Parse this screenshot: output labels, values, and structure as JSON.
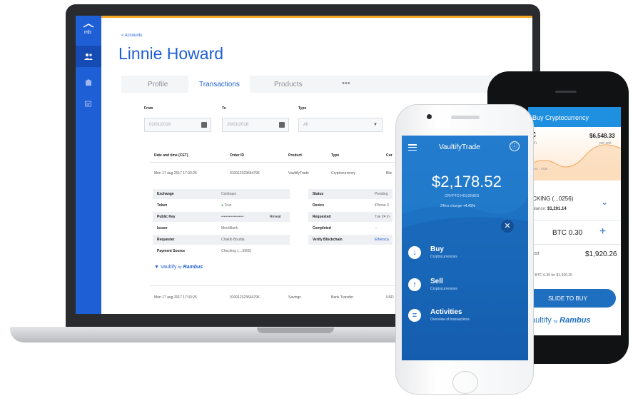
{
  "laptop": {
    "back_link": "« Accounts",
    "client_name": "Linnie Howard",
    "tabs": [
      "Profile",
      "Transactions",
      "Products",
      "•••"
    ],
    "filters": {
      "from_label": "From",
      "from_value": "01/01/2018",
      "to_label": "To",
      "to_value": "20/01/2018",
      "type_label": "Type",
      "type_value": "All"
    },
    "table": {
      "headers": [
        "Date and time (CET)",
        "Order ID",
        "Product",
        "Type",
        "Cur"
      ],
      "rows": [
        [
          "Mon 17 aug 2017 17:33:26",
          "0100123236647​96",
          "VaultifyTrade",
          "Cryptocurrency",
          "Bitc"
        ],
        [
          "Mon 17 aug 2017 17:33:26",
          "0100123236647​96",
          "Savings",
          "Bank Transfer",
          "USD"
        ]
      ]
    },
    "details_left": [
      {
        "k": "Exchange",
        "v": "Coinbase"
      },
      {
        "k": "Token",
        "v": "True"
      },
      {
        "k": "Public Key",
        "v": "••••••••••••••••••",
        "action": "Reveal"
      },
      {
        "k": "Issuer",
        "v": "MockBank"
      },
      {
        "k": "Requester",
        "v": "Chakib Boudia"
      },
      {
        "k": "Payment Source",
        "v": "Checking (....5950)"
      }
    ],
    "details_right": [
      {
        "k": "Status",
        "v": "Pending"
      },
      {
        "k": "Device",
        "v": "iPhone X"
      },
      {
        "k": "Requested",
        "v": "Tue 24 m"
      },
      {
        "k": "Completed",
        "v": "--"
      },
      {
        "k": "Verify Blockchain",
        "v": "Ethersca"
      }
    ],
    "brand": {
      "name": "Vaultify",
      "by": "by",
      "partner": "Rambus"
    }
  },
  "front_phone": {
    "app_title": "VaultifyTrade",
    "balance": "$2,178.52",
    "holdings_label": "CRYPTO HOLDINGS",
    "change_label": "24hrs change",
    "change_value": "+4.41%",
    "actions": [
      {
        "title": "Buy",
        "sub": "Cryptocurrencies",
        "icon": "↓"
      },
      {
        "title": "Sell",
        "sub": "Cryptocurrencies",
        "icon": "↑"
      },
      {
        "title": "Activities",
        "sub": "Overview of transactions",
        "icon": "≡"
      }
    ]
  },
  "back_phone": {
    "header": "Buy Cryptocurrency",
    "coin_short": "C",
    "coin_sub": "oin",
    "price": "$6,548.33",
    "per_unit": "per unit",
    "chart_label": "ours - now",
    "account": "CKING (...0256)",
    "account_bal_label": "alance:",
    "account_bal": "$1,201.14",
    "amount": "BTC 0.30",
    "cost_label": "ost",
    "cost": "$1,920.26",
    "summary": "y BTC 0.30 for $1,920.26",
    "slide": "SLIDE TO BUY",
    "brand": {
      "name": "aultify",
      "by": "by",
      "partner": "Rambus"
    }
  },
  "colors": {
    "primary": "#1f5fd6",
    "accent": "#f5a623",
    "phone_blue": "#1b6ec0"
  }
}
